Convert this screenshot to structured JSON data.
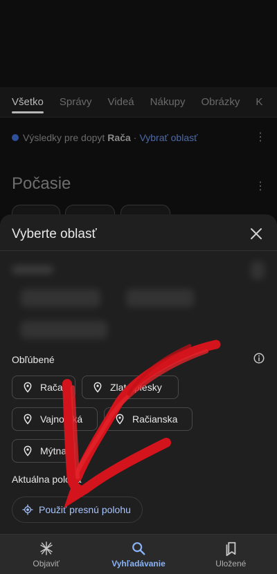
{
  "tabs": [
    "Všetko",
    "Správy",
    "Videá",
    "Nákupy",
    "Obrázky",
    "K"
  ],
  "results": {
    "prefix": "Výsledky pre dopyt",
    "query": "Rača",
    "separator": "·",
    "link": "Vybrať oblasť"
  },
  "weather": {
    "title": "Počasie"
  },
  "sheet": {
    "title": "Vyberte oblasť",
    "favorites_label": "Obľúbené",
    "favorites": [
      "Rača",
      "Zlaté piesky",
      "Vajnorská",
      "Račianska",
      "Mýtna"
    ],
    "current_label": "Aktuálna poloha",
    "precise_label": "Použiť presnú polohu"
  },
  "nav": {
    "items": [
      {
        "label": "Objaviť",
        "icon": "asterisk-icon",
        "active": false
      },
      {
        "label": "Vyhľadávanie",
        "icon": "search-icon",
        "active": true
      },
      {
        "label": "Uložené",
        "icon": "bookmarks-icon",
        "active": false
      }
    ]
  },
  "colors": {
    "accent": "#8ab4f8",
    "annotation_arrow": "#d4141c",
    "sheet_bg": "#1f1f1f"
  }
}
